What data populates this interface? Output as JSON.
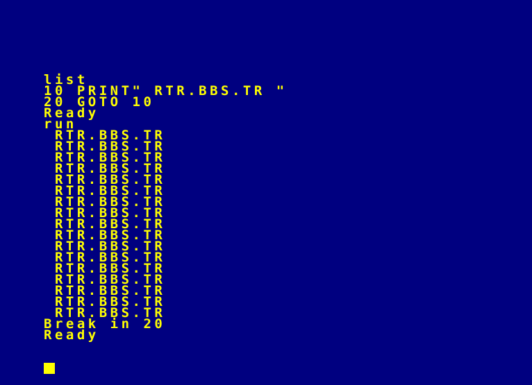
{
  "colors": {
    "background": "#000080",
    "text": "#ffff00",
    "cursor": "#ffff00"
  },
  "terminal": {
    "lines": [
      "list",
      "10 PRINT\" RTR.BBS.TR \"",
      "20 GOTO 10",
      "Ready",
      "run",
      " RTR.BBS.TR",
      " RTR.BBS.TR",
      " RTR.BBS.TR",
      " RTR.BBS.TR",
      " RTR.BBS.TR",
      " RTR.BBS.TR",
      " RTR.BBS.TR",
      " RTR.BBS.TR",
      " RTR.BBS.TR",
      " RTR.BBS.TR",
      " RTR.BBS.TR",
      " RTR.BBS.TR",
      " RTR.BBS.TR",
      " RTR.BBS.TR",
      " RTR.BBS.TR",
      " RTR.BBS.TR",
      " RTR.BBS.TR",
      "Break in 20",
      "Ready"
    ],
    "cursor_visible": true
  }
}
